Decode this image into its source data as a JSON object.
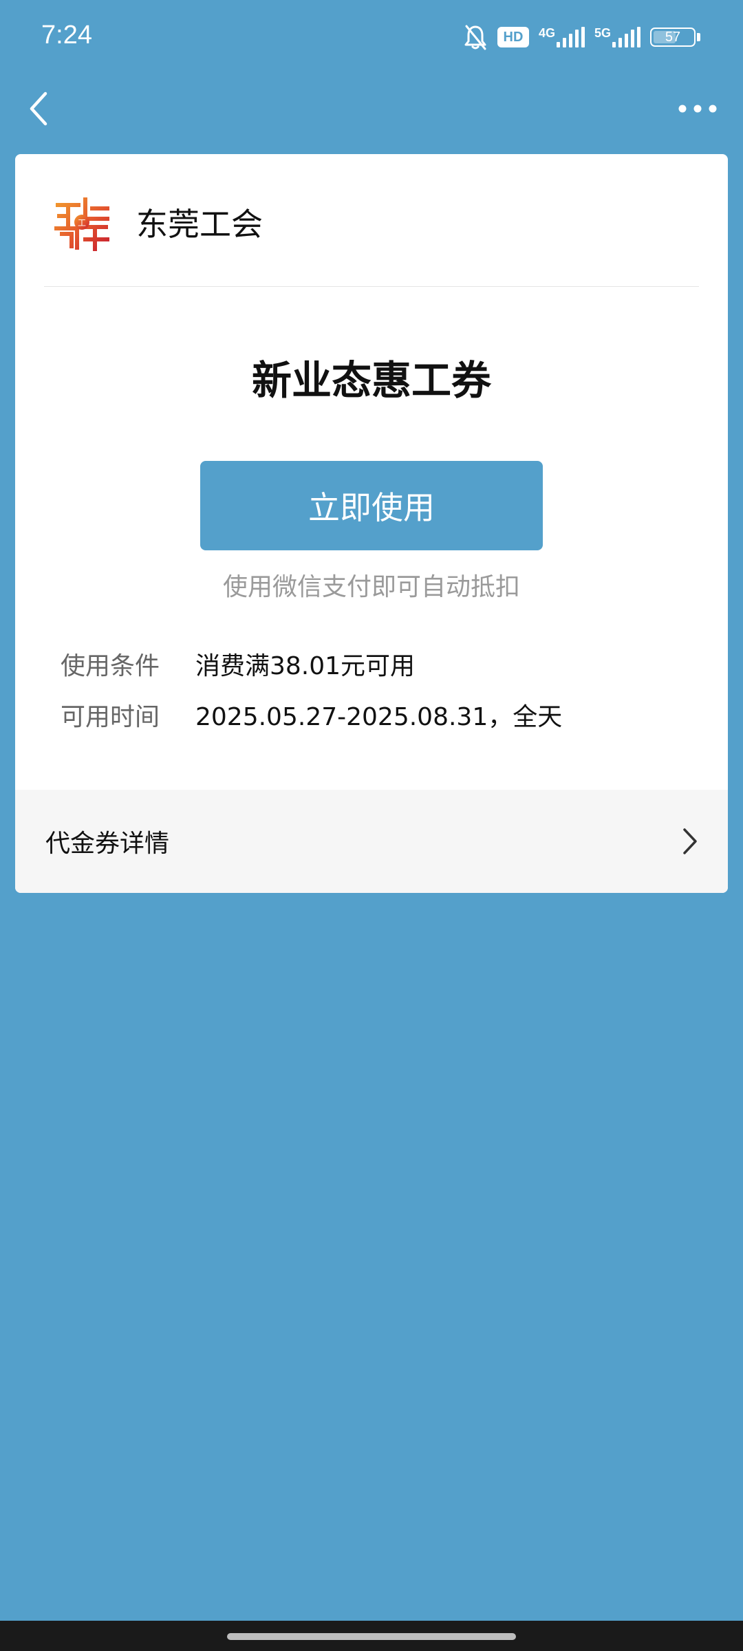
{
  "status_bar": {
    "time": "7:24",
    "hd_label": "HD",
    "net1_label": "4G",
    "net2_label": "5G",
    "battery": "57",
    "battery_level_percent": 57,
    "icons": [
      "mute-bell-icon",
      "hd-icon",
      "signal-4g-icon",
      "signal-5g-icon",
      "battery-icon"
    ]
  },
  "nav": {
    "back_icon": "chevron-left-icon",
    "more_icon": "more-dots-icon"
  },
  "merchant": {
    "name": "东莞工会",
    "logo_icon": "union-seal-logo"
  },
  "coupon": {
    "title": "新业态惠工券",
    "use_button_label": "立即使用",
    "pay_hint": "使用微信支付即可自动抵扣",
    "conditions_label": "使用条件",
    "conditions_value": "消费满38.01元可用",
    "time_label": "可用时间",
    "time_value": "2025.05.27-2025.08.31，全天"
  },
  "details": {
    "label": "代金券详情",
    "chevron_icon": "chevron-right-icon"
  },
  "colors": {
    "background": "#54a0cb",
    "card": "#ffffff",
    "button": "#54a0cb",
    "details_bg": "#f6f6f6"
  }
}
